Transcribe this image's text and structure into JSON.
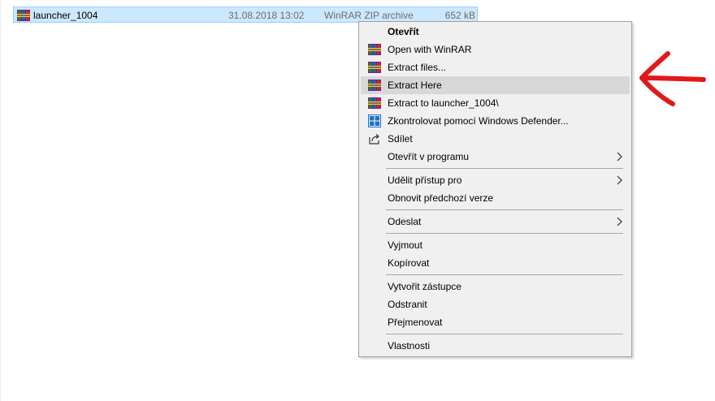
{
  "file": {
    "name": "launcher_1004",
    "date": "31.08.2018 13:02",
    "type": "WinRAR ZIP archive",
    "size": "652 kB"
  },
  "menu": {
    "open": "Otevřít",
    "open_winrar": "Open with WinRAR",
    "extract_files": "Extract files...",
    "extract_here": "Extract Here",
    "extract_to": "Extract to launcher_1004\\",
    "defender_scan": "Zkontrolovat pomocí Windows Defender...",
    "share": "Sdílet",
    "open_with": "Otevřít v programu",
    "grant_access": "Udělit přístup pro",
    "restore_versions": "Obnovit předchozí verze",
    "send_to": "Odeslat",
    "cut": "Vyjmout",
    "copy": "Kopírovat",
    "create_shortcut": "Vytvořit zástupce",
    "delete": "Odstranit",
    "rename": "Přejmenovat",
    "properties": "Vlastnosti"
  },
  "colors": {
    "selection": "#cce8ff",
    "menu_bg": "#f0f0f0",
    "menu_hover": "#d8d8d8",
    "annotation_arrow": "#e0191b",
    "defender_blue": "#1e6fc9"
  },
  "icons": {
    "winrar": "winrar-icon",
    "defender": "windows-defender-icon",
    "share": "share-icon",
    "submenu": "chevron-right-icon"
  },
  "highlighted_item": "extract_here"
}
